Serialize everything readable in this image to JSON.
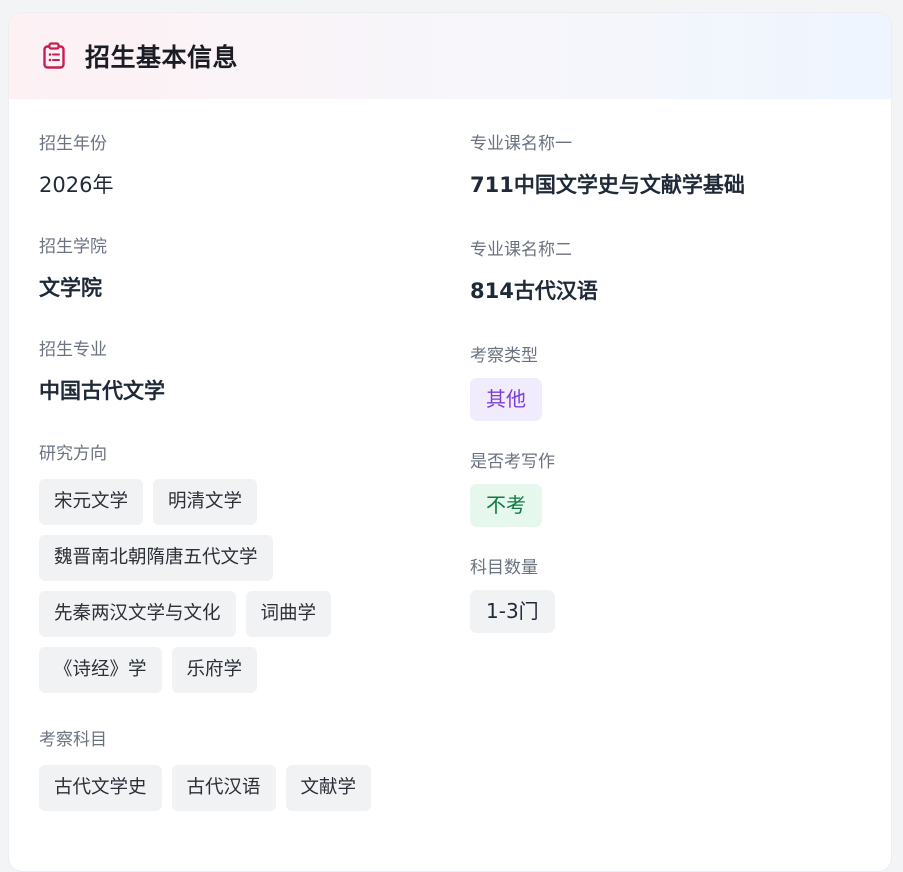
{
  "header": {
    "title": "招生基本信息",
    "icon": "clipboard-icon",
    "icon_color": "#c81e52"
  },
  "left": {
    "year": {
      "label": "招生年份",
      "value": "2026年"
    },
    "college": {
      "label": "招生学院",
      "value": "文学院"
    },
    "major": {
      "label": "招生专业",
      "value": "中国古代文学"
    },
    "directions": {
      "label": "研究方向",
      "tags": [
        "宋元文学",
        "明清文学",
        "魏晋南北朝隋唐五代文学",
        "先秦两汉文学与文化",
        "词曲学",
        "《诗经》学",
        "乐府学"
      ]
    },
    "subjects": {
      "label": "考察科目",
      "tags": [
        "古代文学史",
        "古代汉语",
        "文献学"
      ]
    }
  },
  "right": {
    "course1": {
      "label": "专业课名称一",
      "value": "711中国文学史与文献学基础"
    },
    "course2": {
      "label": "专业课名称二",
      "value": "814古代汉语"
    },
    "exam_type": {
      "label": "考察类型",
      "value": "其他",
      "color": "#7c3fd8"
    },
    "writing": {
      "label": "是否考写作",
      "value": "不考",
      "color": "#0f7a43"
    },
    "count": {
      "label": "科目数量",
      "value": "1-3门"
    }
  }
}
